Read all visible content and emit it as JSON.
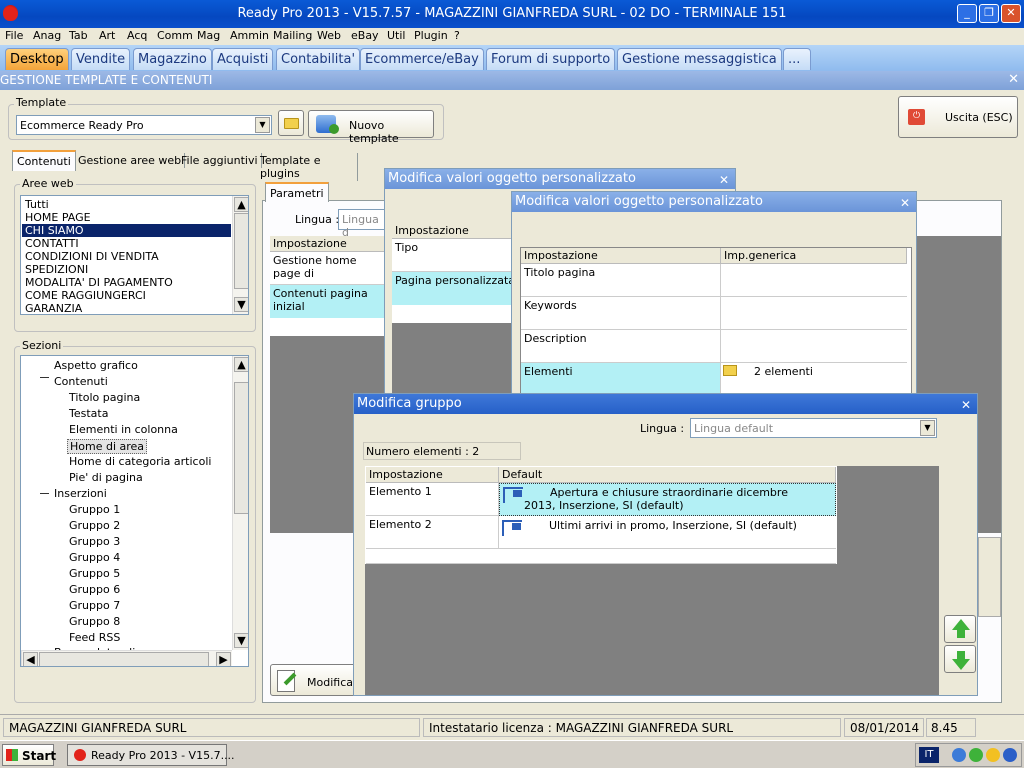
{
  "window": {
    "title": "Ready Pro 2013 - V15.7.57 - MAGAZZINI GIANFREDA SURL - 02 DO - TERMINALE 151"
  },
  "menu": [
    "File",
    "Anag",
    "Tab",
    "Art",
    "Acq",
    "Comm",
    "Mag",
    "Ammin",
    "Mailing",
    "Web",
    "eBay",
    "Util",
    "Plugin",
    "?"
  ],
  "main_tabs": [
    "Desktop",
    "Vendite",
    "Magazzino",
    "Acquisti",
    "Contabilita'",
    "Ecommerce/eBay",
    "Forum di supporto",
    "Gestione messaggistica",
    "..."
  ],
  "section_title": "GESTIONE TEMPLATE E CONTENUTI",
  "template": {
    "label": "Template",
    "value": "Ecommerce Ready Pro",
    "new_button": "Nuovo template",
    "exit_button": "Uscita (ESC)"
  },
  "sub_tabs": [
    "Contenuti",
    "Gestione aree web",
    "File aggiuntivi",
    "Template e plugins"
  ],
  "aree_web": {
    "label": "Aree web",
    "items": [
      "Tutti",
      "HOME PAGE",
      "CHI SIAMO",
      "CONTATTI",
      "CONDIZIONI DI VENDITA",
      "SPEDIZIONI",
      "MODALITA' DI PAGAMENTO",
      "COME RAGGIUNGERCI",
      "GARANZIA"
    ],
    "selected": "CHI SIAMO"
  },
  "sezioni": {
    "label": "Sezioni",
    "items": [
      "Aspetto grafico",
      "Contenuti",
      "Titolo pagina",
      "Testata",
      "Elementi in colonna",
      "Home di area",
      "Home di categoria articoli",
      "Pie' di pagina",
      "Inserzioni",
      "Gruppo 1",
      "Gruppo 2",
      "Gruppo 3",
      "Gruppo 4",
      "Gruppo 5",
      "Gruppo 6",
      "Gruppo 7",
      "Gruppo 8",
      "Feed RSS"
    ],
    "selected": "Home di area",
    "cut_item": "Banner laterali"
  },
  "params": {
    "tab": "Parametri",
    "lingua_label": "Lingua :",
    "lingua_value": "Lingua d",
    "col_header": "Impostazione",
    "rows": [
      "Gestione home page di",
      "Contenuti pagina inizial"
    ],
    "modify_button": "Modifica"
  },
  "dialog1": {
    "title": "Modifica valori oggetto personalizzato",
    "col_header": "Impostazione",
    "rows": [
      "Tipo",
      "Pagina personalizzata"
    ]
  },
  "dialog2": {
    "title": "Modifica valori oggetto personalizzato",
    "col1": "Impostazione",
    "col2": "Imp.generica",
    "rows": [
      {
        "name": "Titolo pagina",
        "value": ""
      },
      {
        "name": "Keywords",
        "value": ""
      },
      {
        "name": "Description",
        "value": ""
      },
      {
        "name": "Elementi",
        "value": "2 elementi"
      }
    ]
  },
  "dialog3": {
    "title": "Modifica gruppo",
    "lingua_label": "Lingua :",
    "lingua_value": "Lingua default",
    "count": "Numero elementi : 2",
    "col1": "Impostazione",
    "col2": "Default",
    "rows": [
      {
        "name": "Elemento 1",
        "value": "Apertura e chiusure straordinarie dicembre 2013, Inserzione, SI (default)"
      },
      {
        "name": "Elemento 2",
        "value": "Ultimi arrivi in promo, Inserzione, SI (default)"
      }
    ]
  },
  "statusbar": {
    "company": "MAGAZZINI GIANFREDA SURL",
    "license": "Intestatario licenza : MAGAZZINI GIANFREDA SURL",
    "date": "08/01/2014",
    "time": "8.45"
  },
  "taskbar": {
    "start": "Start",
    "task": "Ready Pro 2013 - V15.7....",
    "lang": "IT"
  },
  "colors": {
    "accent_blue": "#0a5ad6",
    "selected_row": "#b3f0f5",
    "orange_tab": "#f3a43a"
  }
}
